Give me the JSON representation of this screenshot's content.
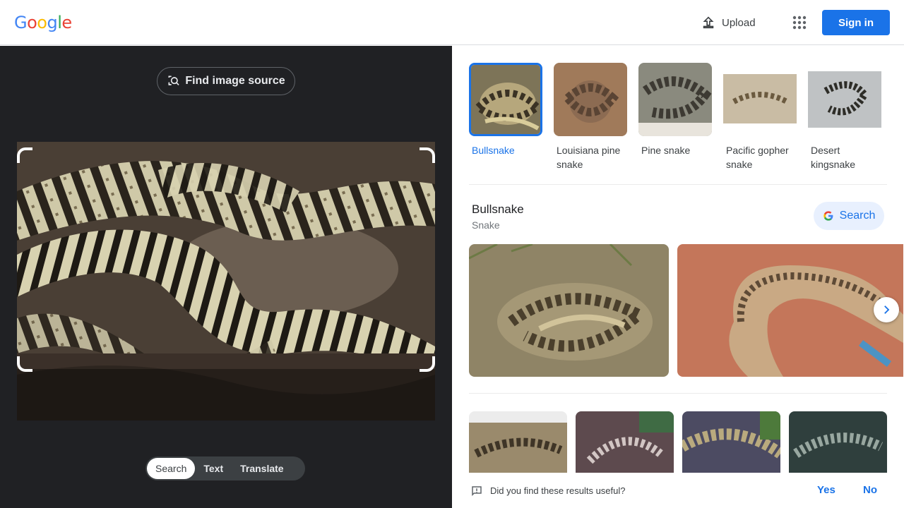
{
  "header": {
    "logo_letters": [
      "G",
      "o",
      "o",
      "g",
      "l",
      "e"
    ],
    "logo_colors": [
      "#4285f4",
      "#ea4335",
      "#fbbc05",
      "#4285f4",
      "#34a853",
      "#ea4335"
    ],
    "upload_label": "Upload",
    "signin_label": "Sign in"
  },
  "left": {
    "find_source_label": "Find image source",
    "modes": [
      {
        "label": "Search",
        "active": true
      },
      {
        "label": "Text",
        "active": false
      },
      {
        "label": "Translate",
        "active": false
      }
    ]
  },
  "matches": [
    {
      "label": "Bullsnake",
      "selected": true
    },
    {
      "label": "Louisiana pine snake",
      "selected": false
    },
    {
      "label": "Pine snake",
      "selected": false
    },
    {
      "label": "Pacific gopher snake",
      "selected": false
    },
    {
      "label": "Desert kingsnake",
      "selected": false
    }
  ],
  "knowledge": {
    "title": "Bullsnake",
    "subtitle": "Snake",
    "search_label": "Search"
  },
  "feedback": {
    "question": "Did you find these results useful?",
    "yes": "Yes",
    "no": "No"
  },
  "colors": {
    "accent": "#1a73e8",
    "dark_panel": "#202124"
  }
}
